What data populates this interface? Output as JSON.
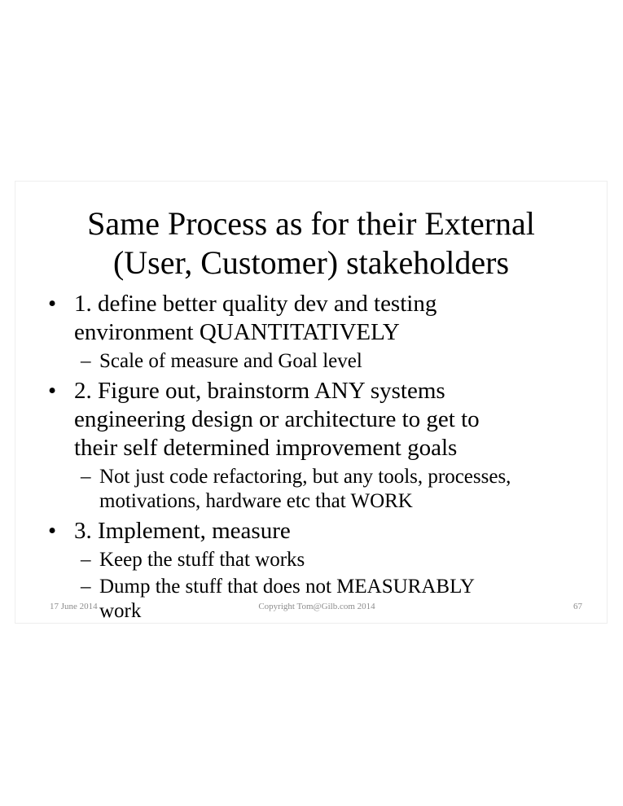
{
  "slide": {
    "title_lines": [
      "Same Process as for their External",
      "(User, Customer) stakeholders"
    ],
    "bullets": [
      {
        "marker": "•",
        "lines": [
          "1. define better quality dev and testing",
          "environment QUANTITATIVELY"
        ],
        "subs": [
          {
            "marker": "–",
            "lines": [
              "Scale of measure and Goal level"
            ]
          }
        ]
      },
      {
        "marker": "•",
        "lines": [
          "2. Figure out, brainstorm ANY systems",
          "engineering design or architecture to get to",
          "their self determined improvement goals"
        ],
        "subs": [
          {
            "marker": "–",
            "lines": [
              "Not just code refactoring, but any tools, processes,",
              "motivations, hardware etc that WORK"
            ]
          }
        ]
      },
      {
        "marker": "•",
        "lines": [
          "3. Implement, measure"
        ],
        "subs": [
          {
            "marker": "–",
            "lines": [
              "Keep the stuff that works"
            ]
          },
          {
            "marker": "–",
            "lines": [
              "Dump the stuff that does not MEASURABLY",
              "work"
            ]
          }
        ]
      }
    ],
    "footer": {
      "date": "17 June 2014",
      "copyright": "Copyright Tom@Gilb.com 2014",
      "page_number": "67"
    }
  }
}
